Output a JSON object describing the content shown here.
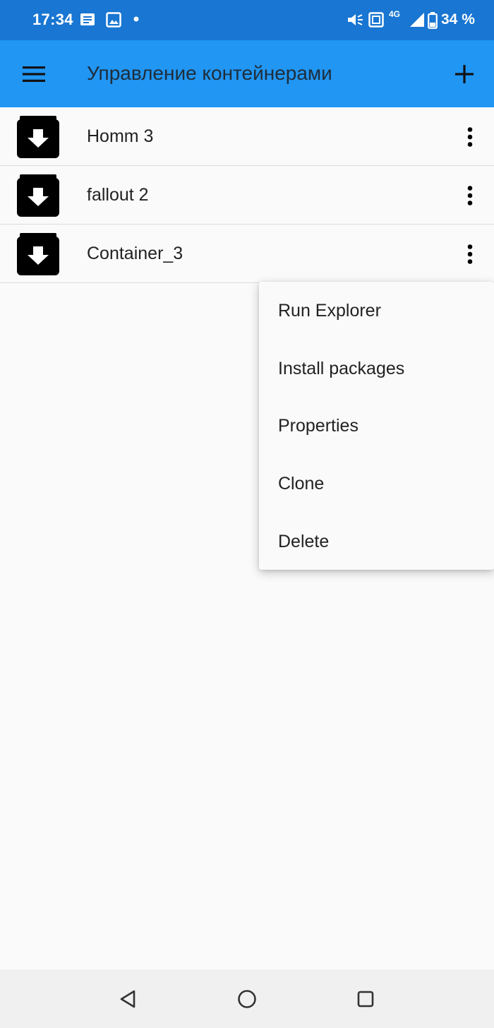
{
  "status_bar": {
    "time": "17:34",
    "network": "4G",
    "battery": "34 %",
    "icons": [
      "message-icon",
      "image-icon",
      "dot-icon",
      "speaker-icon",
      "nfc-icon",
      "signal-icon",
      "battery-icon"
    ]
  },
  "app_bar": {
    "title": "Управление контейнерами",
    "menu_icon": "hamburger-menu-icon",
    "add_icon": "plus-icon",
    "color": "#2196f3"
  },
  "containers": [
    {
      "label": "Homm 3",
      "icon": "archive-download-icon"
    },
    {
      "label": "fallout 2",
      "icon": "archive-download-icon"
    },
    {
      "label": "Container_3",
      "icon": "archive-download-icon"
    }
  ],
  "popup_menu": {
    "items": [
      {
        "label": "Run Explorer"
      },
      {
        "label": "Install packages"
      },
      {
        "label": "Properties"
      },
      {
        "label": "Clone"
      },
      {
        "label": "Delete"
      }
    ]
  },
  "nav_bar": {
    "buttons": [
      "back-icon",
      "home-icon",
      "recents-icon"
    ]
  }
}
